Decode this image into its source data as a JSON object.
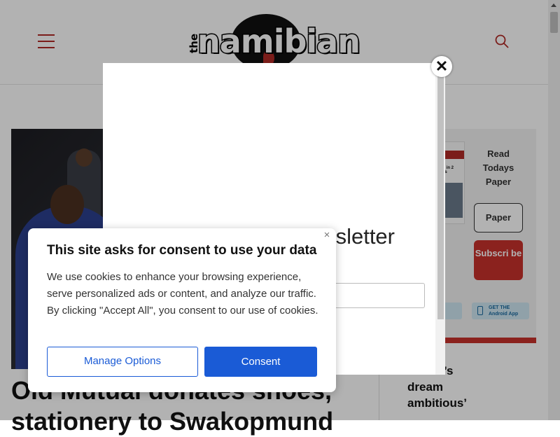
{
  "header": {
    "logo_prefix": "the",
    "logo_text": "namibian"
  },
  "hero": {
    "headline": "Old Mutual donates shoes, stationery to Swakopmund"
  },
  "sidebar": {
    "read_label": "Read Todays Paper",
    "paper_button": "Paper",
    "subscribe_button": "Subscri be",
    "android_store": "GET THE Android App",
    "thumb_text": "nger in 2 years",
    "side_headline": "…mini’s dream ambitious’"
  },
  "newsletter": {
    "heading": "sletter"
  },
  "consent": {
    "title": "This site asks for consent to use your data",
    "body": "We use cookies to enhance your browsing experience, serve personalized ads or content, and analyze our traffic. By clicking \"Accept All\", you consent to our use of cookies.",
    "close_label": "×",
    "manage_button": "Manage Options",
    "consent_button": "Consent"
  },
  "colors": {
    "brand_red": "#c8312c",
    "consent_blue": "#1a5bd6"
  }
}
